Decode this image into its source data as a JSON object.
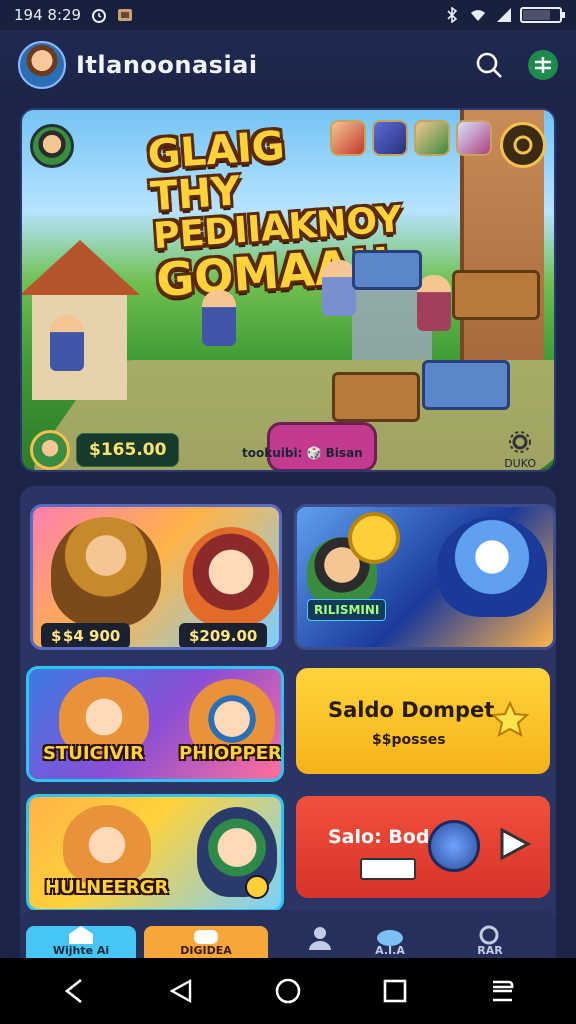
{
  "status_bar": {
    "time": "194 8:29",
    "icons": [
      "alarm-icon",
      "notification-icon",
      "bluetooth-icon",
      "wifi-icon",
      "signal-icon",
      "battery-icon"
    ]
  },
  "app_bar": {
    "title": "Itlanoonasiai",
    "actions": [
      "search-icon",
      "add-icon"
    ]
  },
  "hero": {
    "title_line1": "GLAIG THY",
    "title_line2": "PEDIIAKNOY",
    "title_line3": "GOMAA!!",
    "price": "$165.00",
    "center_text": "tookuibi: 🎲 Bisan",
    "corner_label": "DUKO"
  },
  "cards": {
    "card1": {
      "price_left": "$ $4 900",
      "price_right": "$209.00"
    },
    "card2": {
      "label": "RILISMINI"
    },
    "card3": {
      "label_left": "STUICIVIR",
      "label_right": "PHIOPPER"
    },
    "card4": {
      "title": "Saldo Dompet",
      "subtitle": "$$posses"
    },
    "card5": {
      "label": "HULNEERGR"
    },
    "card6": {
      "title": "Salo: Bod"
    }
  },
  "app_nav": {
    "tab1": "Wijhte Ai",
    "tab2": "DIGIDEA",
    "tab3": "",
    "tab4": "A.I.A",
    "tab5": "RAR"
  },
  "colors": {
    "background": "#1c2547",
    "panel": "#2a3564",
    "accent_yellow": "#ffd43b",
    "accent_red": "#e0412f",
    "accent_cyan": "#2ec4f4"
  }
}
